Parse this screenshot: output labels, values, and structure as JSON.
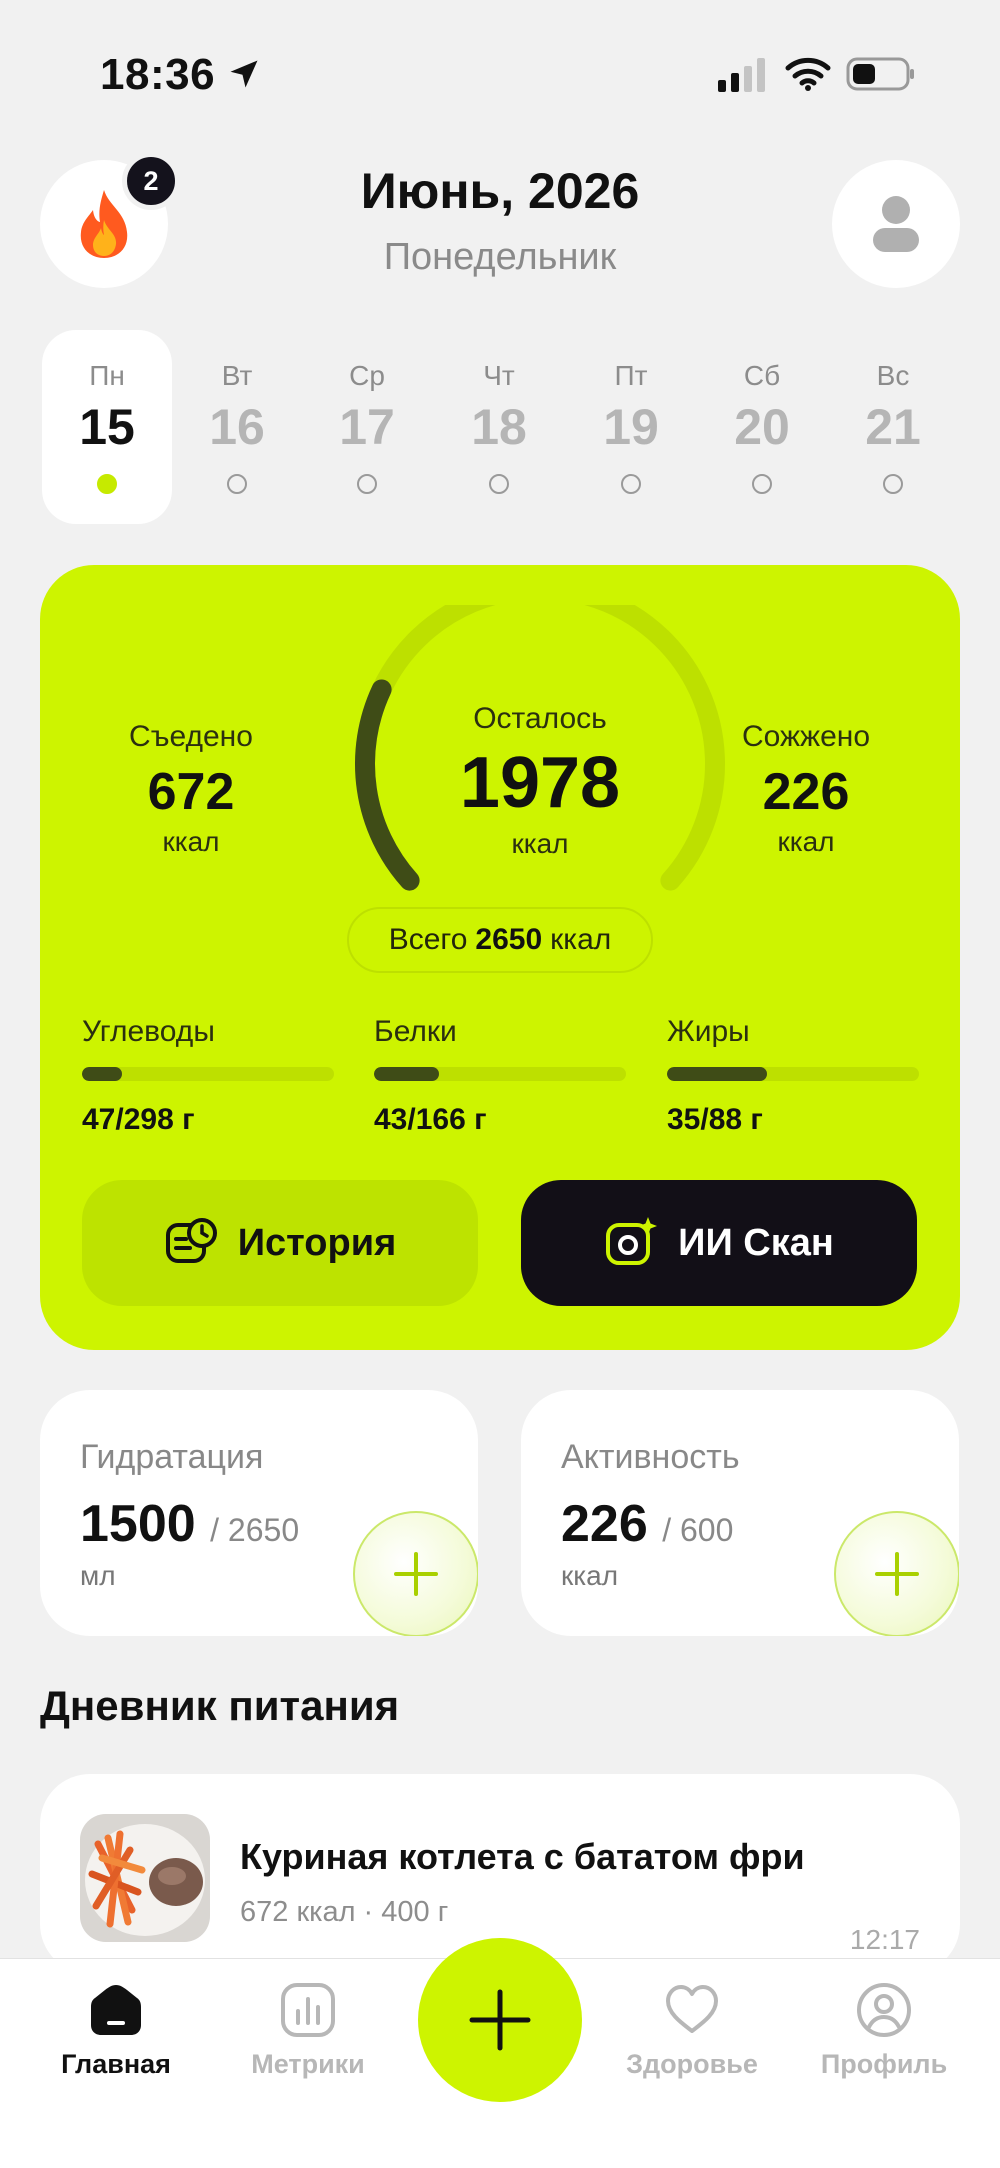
{
  "status_bar": {
    "time": "18:36",
    "icons": [
      "location-arrow-icon",
      "cellular-signal-icon",
      "wifi-icon",
      "battery-icon"
    ]
  },
  "header": {
    "streak_count": "2",
    "month_year": "Июнь, 2026",
    "weekday": "Понедельник",
    "streak_icon": "flame-icon",
    "avatar_icon": "user-icon"
  },
  "week": [
    {
      "name": "Пн",
      "num": "15",
      "selected": true
    },
    {
      "name": "Вт",
      "num": "16",
      "selected": false
    },
    {
      "name": "Ср",
      "num": "17",
      "selected": false
    },
    {
      "name": "Чт",
      "num": "18",
      "selected": false
    },
    {
      "name": "Пт",
      "num": "19",
      "selected": false
    },
    {
      "name": "Сб",
      "num": "20",
      "selected": false
    },
    {
      "name": "Вс",
      "num": "21",
      "selected": false
    }
  ],
  "calories": {
    "eaten_label": "Съедено",
    "eaten_value": "672",
    "eaten_unit": "ккал",
    "remaining_label": "Осталось",
    "remaining_value": "1978",
    "remaining_unit": "ккал",
    "burned_label": "Сожжено",
    "burned_value": "226",
    "burned_unit": "ккал",
    "total_prefix": "Всего",
    "total_value": "2650",
    "total_unit": "ккал",
    "gauge_progress": 0.254,
    "accent_color": "#cdf400",
    "macros": [
      {
        "label": "Углеводы",
        "value": "47/298 г",
        "fraction": 0.158
      },
      {
        "label": "Белки",
        "value": "43/166 г",
        "fraction": 0.259
      },
      {
        "label": "Жиры",
        "value": "35/88 г",
        "fraction": 0.398
      }
    ],
    "history_label": "История",
    "scan_label": "ИИ Скан"
  },
  "hydration": {
    "title": "Гидратация",
    "value": "1500",
    "goal": "/ 2650",
    "unit": "мл"
  },
  "activity": {
    "title": "Активность",
    "value": "226",
    "goal": "/ 600",
    "unit": "ккал"
  },
  "diary": {
    "title": "Дневник питания",
    "meals": [
      {
        "name": "Куриная котлета с бататом фри",
        "meta": "672 ккал · 400 г",
        "time": "12:17"
      }
    ]
  },
  "tabbar": {
    "home": "Главная",
    "metrics": "Метрики",
    "health": "Здоровье",
    "profile": "Профиль"
  }
}
